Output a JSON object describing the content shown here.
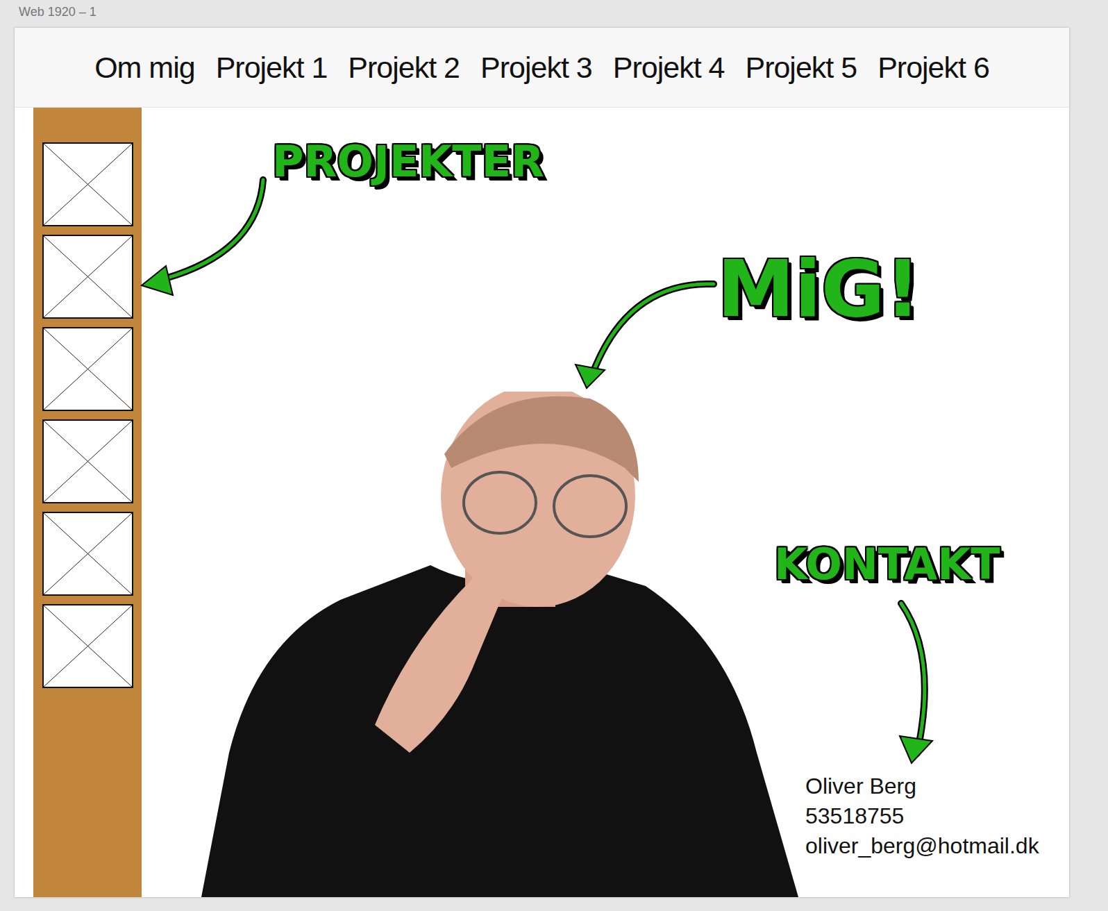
{
  "artboard": {
    "title": "Web 1920 – 1"
  },
  "nav": {
    "items": [
      "Om mig",
      "Projekt 1",
      "Projekt 2",
      "Projekt 3",
      "Projekt 4",
      "Projekt 5",
      "Projekt 6"
    ]
  },
  "sidebar": {
    "slots": [
      {
        "kind": "placeholder"
      },
      {
        "kind": "placeholder"
      },
      {
        "kind": "placeholder"
      },
      {
        "kind": "placeholder"
      },
      {
        "kind": "placeholder"
      },
      {
        "kind": "placeholder"
      }
    ]
  },
  "callouts": [
    {
      "label": "PROJEKTER"
    },
    {
      "label": "MiG!"
    },
    {
      "label": "KONTAKT"
    }
  ],
  "contact": {
    "lines": [
      "Oliver Berg",
      "53518755",
      "oliver_berg@hotmail.dk"
    ]
  }
}
